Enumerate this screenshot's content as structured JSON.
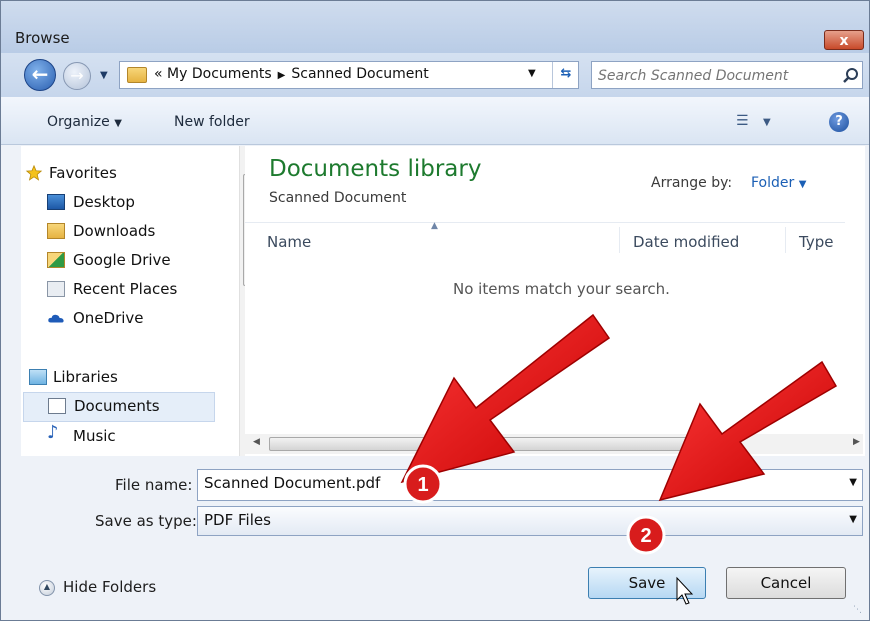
{
  "window": {
    "title": "Browse",
    "close_label": "x"
  },
  "address_bar": {
    "overflow": "«",
    "crumbs": [
      "My Documents",
      "Scanned Document"
    ]
  },
  "search": {
    "placeholder": "Search Scanned Document"
  },
  "toolbar": {
    "organize_label": "Organize",
    "new_folder_label": "New folder"
  },
  "nav_pane": {
    "favorites": {
      "label": "Favorites",
      "items": [
        "Desktop",
        "Downloads",
        "Google Drive",
        "Recent Places",
        "OneDrive"
      ]
    },
    "libraries": {
      "label": "Libraries",
      "items": [
        "Documents",
        "Music"
      ]
    },
    "selected": "Documents"
  },
  "content": {
    "library_title": "Documents library",
    "library_subtitle": "Scanned Document",
    "arrange_label": "Arrange by:",
    "arrange_value": "Folder",
    "columns": [
      "Name",
      "Date modified",
      "Type"
    ],
    "empty_message": "No items match your search."
  },
  "form": {
    "file_name_label": "File name:",
    "file_name_value": "Scanned Document.pdf",
    "save_type_label": "Save as type:",
    "save_type_value": "PDF Files"
  },
  "footer": {
    "hide_folders_label": "Hide Folders",
    "save_label": "Save",
    "cancel_label": "Cancel"
  },
  "annotations": {
    "step1": "1",
    "step2": "2"
  },
  "colors": {
    "arrow": "#e01010",
    "badge": "#d81c1c",
    "library_title": "#1d7a2e",
    "link": "#1b5fb5"
  }
}
